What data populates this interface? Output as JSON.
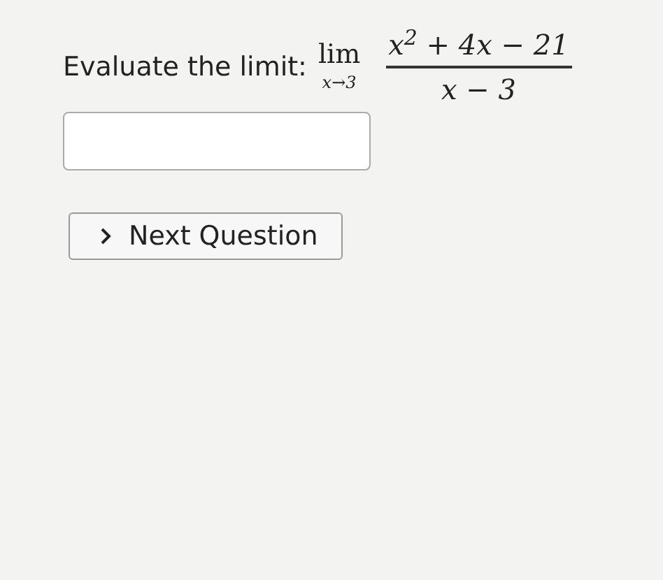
{
  "question": {
    "label": "Evaluate the limit:",
    "limit": {
      "operator": "lim",
      "subscript": "x→3",
      "numerator": "x$^{2}$ + 4x − 21",
      "denominator": "x − 3"
    }
  },
  "button": {
    "label": "Next Question"
  }
}
